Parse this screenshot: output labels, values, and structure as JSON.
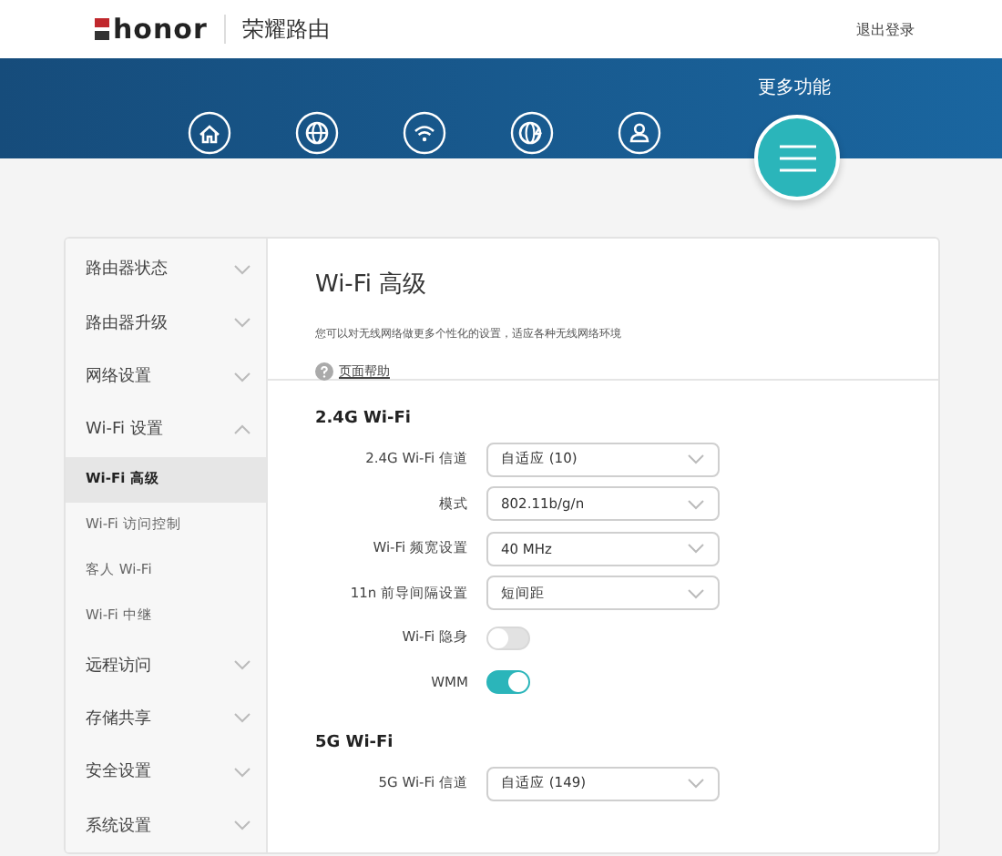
{
  "header": {
    "brand": "honor",
    "title": "荣耀路由",
    "logout": "退出登录"
  },
  "nav": {
    "items": [
      {
        "kind": "home",
        "selected": false
      },
      {
        "kind": "globe",
        "selected": false
      },
      {
        "kind": "wifi",
        "selected": false
      },
      {
        "kind": "globe-bolt",
        "selected": false
      },
      {
        "kind": "user",
        "selected": false
      }
    ],
    "more": {
      "label": "更多功能",
      "selected": true
    }
  },
  "sidebar": {
    "items": [
      {
        "label": "路由器状态",
        "expanded": false
      },
      {
        "label": "路由器升级",
        "expanded": false
      },
      {
        "label": "网络设置",
        "expanded": false
      },
      {
        "label": "Wi-Fi 设置",
        "expanded": true,
        "children": [
          {
            "label": "Wi-Fi 高级",
            "selected": true
          },
          {
            "label": "Wi-Fi 访问控制",
            "selected": false
          },
          {
            "label": "客人 Wi-Fi",
            "selected": false
          },
          {
            "label": "Wi-Fi 中继",
            "selected": false
          }
        ]
      },
      {
        "label": "远程访问",
        "expanded": false
      },
      {
        "label": "存储共享",
        "expanded": false
      },
      {
        "label": "安全设置",
        "expanded": false
      },
      {
        "label": "系统设置",
        "expanded": false
      }
    ]
  },
  "main": {
    "title": "Wi-Fi 高级",
    "description": "您可以对无线网络做更多个性化的设置，适应各种无线网络环境",
    "help": "页面帮助",
    "sections": [
      {
        "title": "2.4G Wi-Fi",
        "rows": [
          {
            "kind": "select",
            "label": "2.4G Wi-Fi 信道",
            "value": "自适应 (10)"
          },
          {
            "kind": "select",
            "label": "模式",
            "value": "802.11b/g/n"
          },
          {
            "kind": "select",
            "label": "Wi-Fi 频宽设置",
            "value": "40 MHz"
          },
          {
            "kind": "select",
            "label": "11n 前导间隔设置",
            "value": "短间距"
          },
          {
            "kind": "toggle",
            "label": "Wi-Fi 隐身",
            "on": false
          },
          {
            "kind": "toggle",
            "label": "WMM",
            "on": true
          }
        ]
      },
      {
        "title": "5G Wi-Fi",
        "rows": [
          {
            "kind": "select",
            "label": "5G Wi-Fi 信道",
            "value": "自适应 (149)"
          }
        ]
      }
    ]
  }
}
